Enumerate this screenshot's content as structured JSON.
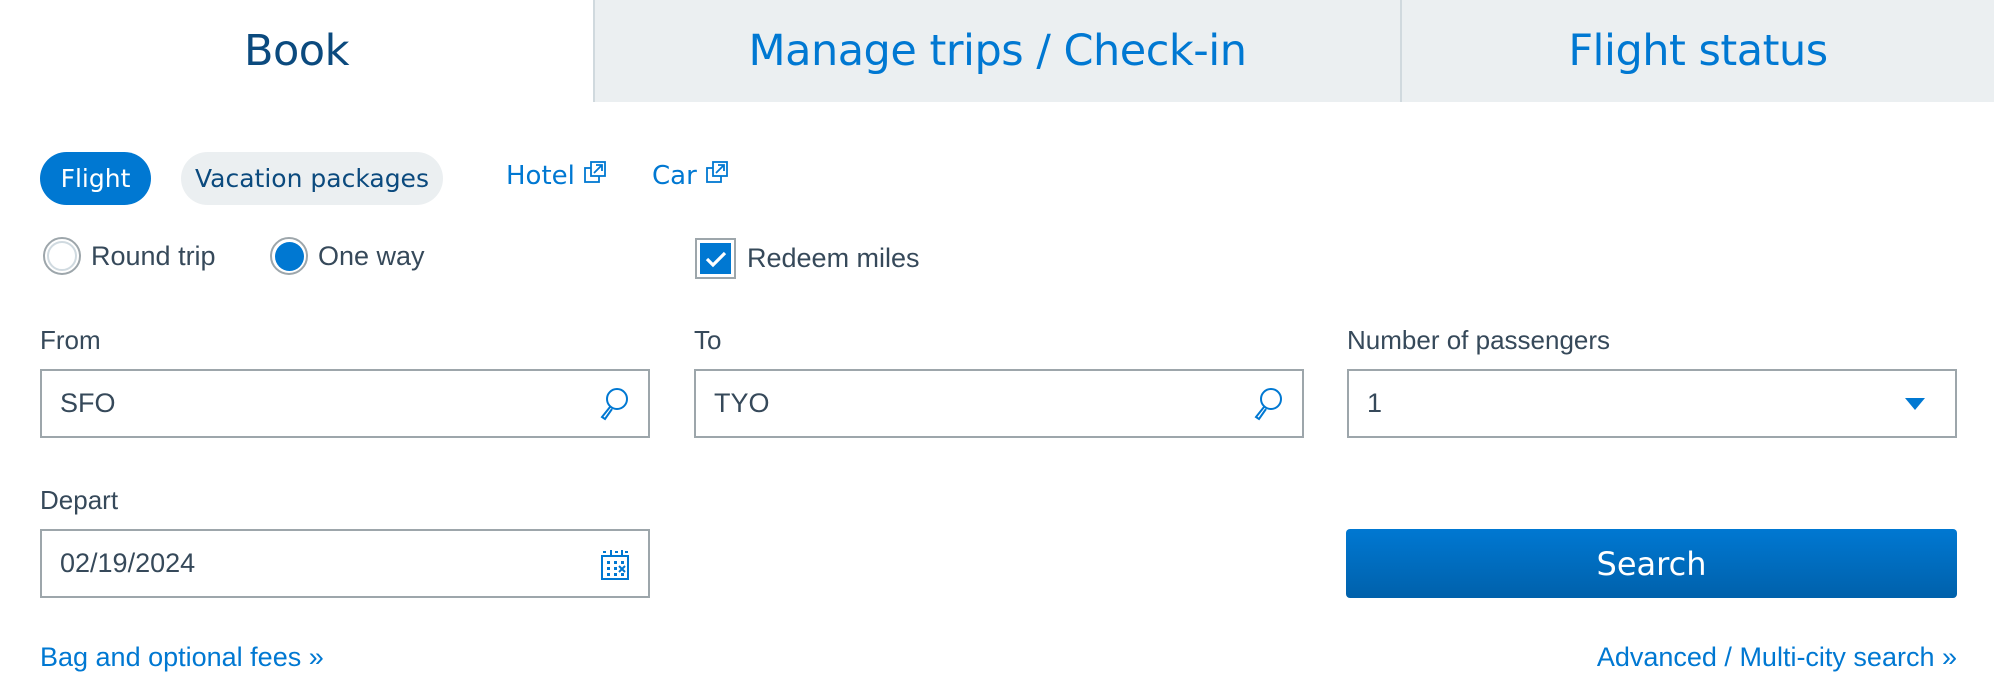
{
  "tabs": [
    {
      "label": "Book",
      "active": true
    },
    {
      "label": "Manage trips / Check-in",
      "active": false
    },
    {
      "label": "Flight status",
      "active": false
    }
  ],
  "product_pills": {
    "flight": {
      "label": "Flight",
      "selected": true
    },
    "vacation": {
      "label": "Vacation packages",
      "selected": false
    }
  },
  "external_links": {
    "hotel": {
      "label": "Hotel",
      "icon": "external-link-icon"
    },
    "car": {
      "label": "Car",
      "icon": "external-link-icon"
    }
  },
  "trip_type": {
    "options": [
      {
        "label": "Round trip",
        "checked": false
      },
      {
        "label": "One way",
        "checked": true
      }
    ]
  },
  "redeem_miles": {
    "label": "Redeem miles",
    "checked": true
  },
  "form": {
    "from": {
      "label": "From",
      "value": "SFO",
      "icon": "search-icon"
    },
    "to": {
      "label": "To",
      "value": "TYO",
      "icon": "search-icon"
    },
    "passengers": {
      "label": "Number of passengers",
      "value": "1",
      "icon": "chevron-down-icon"
    },
    "depart": {
      "label": "Depart",
      "value": "02/19/2024",
      "icon": "calendar-icon"
    }
  },
  "search_button": {
    "label": "Search"
  },
  "links": {
    "bag_fees": "Bag and optional fees »",
    "advanced_search": "Advanced / Multi-city search »"
  },
  "colors": {
    "accent": "#0078d2",
    "tab_active_text": "#0b4a7e",
    "tab_inactive_bg": "#ebeff1",
    "text": "#36495a"
  }
}
